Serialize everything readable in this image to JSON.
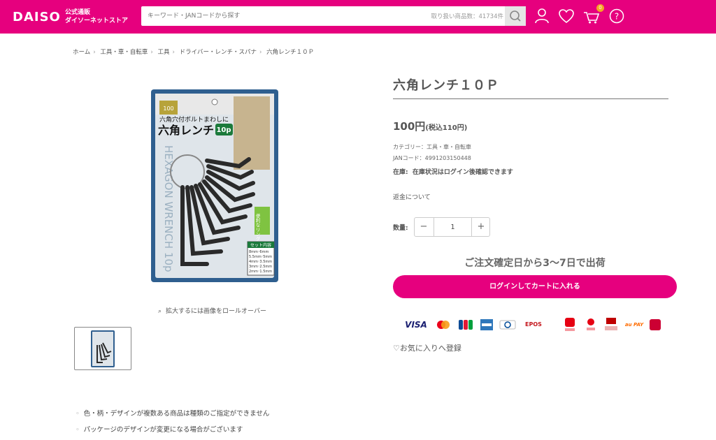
{
  "header": {
    "logo": "DAISO",
    "logo_sub_line1": "公式通販",
    "logo_sub_line2": "ダイソーネットストア",
    "search_placeholder": "キーワード・JANコードから探す",
    "search_count": "取り扱い商品数：41734件",
    "cart_badge": "0",
    "accent_color": "#e6007e"
  },
  "breadcrumb": [
    "ホーム",
    "工具・車・自転車",
    "工具",
    "ドライバー・レンチ・スパナ",
    "六角レンチ１０Ｐ"
  ],
  "gallery": {
    "zoom_hint": "拡大するには画像をロールオーバー",
    "package": {
      "badge": "100",
      "headline": "六角穴付ボルトまわしに",
      "name": "六角レンチ",
      "count": "10p",
      "side_text": "HEXAGON WRENCH 10p",
      "callout": "便利なリング付き",
      "set_title": "セット内容",
      "set_lines": [
        "8mm･6mm",
        "5.5mm･5mm",
        "4mm･3.5mm",
        "3mm･2.5mm",
        "2mm･1.5mm"
      ]
    }
  },
  "notes": [
    "色・柄・デザインが複数ある商品は種類のご指定ができません",
    "パッケージのデザインが変更になる場合がございます"
  ],
  "product": {
    "title": "六角レンチ１０Ｐ",
    "price": "100円",
    "price_tax": "(税込110円)",
    "category": "カテゴリー：工具・車・自転車",
    "jan": "JANコード：4991203150448",
    "stock_label": "在庫:",
    "stock_value": "在庫状況はログイン後確認できます",
    "refund_link": "返金について",
    "qty_label": "数量:",
    "qty_value": "1",
    "qty_minus": "−",
    "qty_plus": "+",
    "shipping": "ご注文確定日から3〜7日で出荷",
    "cart_button": "ログインしてカートに入れる",
    "favorite": "お気に入りへ登録"
  },
  "payments": [
    "VISA",
    "Mastercard",
    "JCB",
    "AMEX",
    "Diners Club",
    "EPOS",
    "PayPay",
    "d払い Pay",
    "楽天ペイ",
    "au PAY",
    "d払い"
  ]
}
